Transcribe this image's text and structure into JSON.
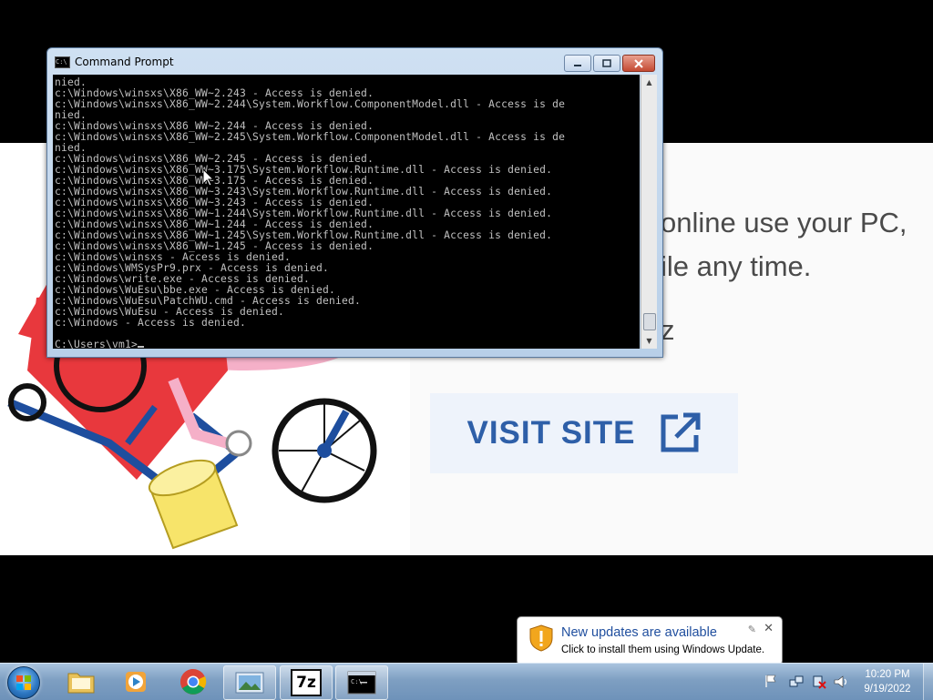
{
  "background_page": {
    "lines": [
      "online use your PC,",
      "ile any time.",
      "z"
    ],
    "visit_button_label": "VISIT SITE",
    "colors": {
      "accent": "#2e5fa8",
      "text": "#4a4a4a"
    }
  },
  "cmd_window": {
    "title": "Command Prompt",
    "output_lines": [
      "nied.",
      "c:\\Windows\\winsxs\\X86_WW~2.243 - Access is denied.",
      "c:\\Windows\\winsxs\\X86_WW~2.244\\System.Workflow.ComponentModel.dll - Access is de",
      "nied.",
      "c:\\Windows\\winsxs\\X86_WW~2.244 - Access is denied.",
      "c:\\Windows\\winsxs\\X86_WW~2.245\\System.Workflow.ComponentModel.dll - Access is de",
      "nied.",
      "c:\\Windows\\winsxs\\X86_WW~2.245 - Access is denied.",
      "c:\\Windows\\winsxs\\X86_WW~3.175\\System.Workflow.Runtime.dll - Access is denied.",
      "c:\\Windows\\winsxs\\X86_WW~3.175 - Access is denied.",
      "c:\\Windows\\winsxs\\X86_WW~3.243\\System.Workflow.Runtime.dll - Access is denied.",
      "c:\\Windows\\winsxs\\X86_WW~3.243 - Access is denied.",
      "c:\\Windows\\winsxs\\X86_WW~1.244\\System.Workflow.Runtime.dll - Access is denied.",
      "c:\\Windows\\winsxs\\X86_WW~1.244 - Access is denied.",
      "c:\\Windows\\winsxs\\X86_WW~1.245\\System.Workflow.Runtime.dll - Access is denied.",
      "c:\\Windows\\winsxs\\X86_WW~1.245 - Access is denied.",
      "c:\\Windows\\winsxs - Access is denied.",
      "c:\\Windows\\WMSysPr9.prx - Access is denied.",
      "c:\\Windows\\write.exe - Access is denied.",
      "c:\\Windows\\WuEsu\\bbe.exe - Access is denied.",
      "c:\\Windows\\WuEsu\\PatchWU.cmd - Access is denied.",
      "c:\\Windows\\WuEsu - Access is denied.",
      "c:\\Windows - Access is denied.",
      ""
    ],
    "prompt": "C:\\Users\\vm1>"
  },
  "notification": {
    "title": "New updates are available",
    "text": "Click to install them using Windows Update."
  },
  "taskbar": {
    "pinned": [
      {
        "name": "windows-explorer",
        "icon": "folder-icon"
      },
      {
        "name": "media-player",
        "icon": "media-player-icon"
      },
      {
        "name": "chrome",
        "icon": "chrome-icon"
      },
      {
        "name": "photo-viewer",
        "icon": "photo-icon"
      },
      {
        "name": "7zip",
        "icon": "7zip-icon",
        "label": "7z"
      },
      {
        "name": "command-prompt",
        "icon": "cmd-icon",
        "active": true
      }
    ],
    "clock": {
      "time": "10:20 PM",
      "date": "9/19/2022"
    }
  }
}
